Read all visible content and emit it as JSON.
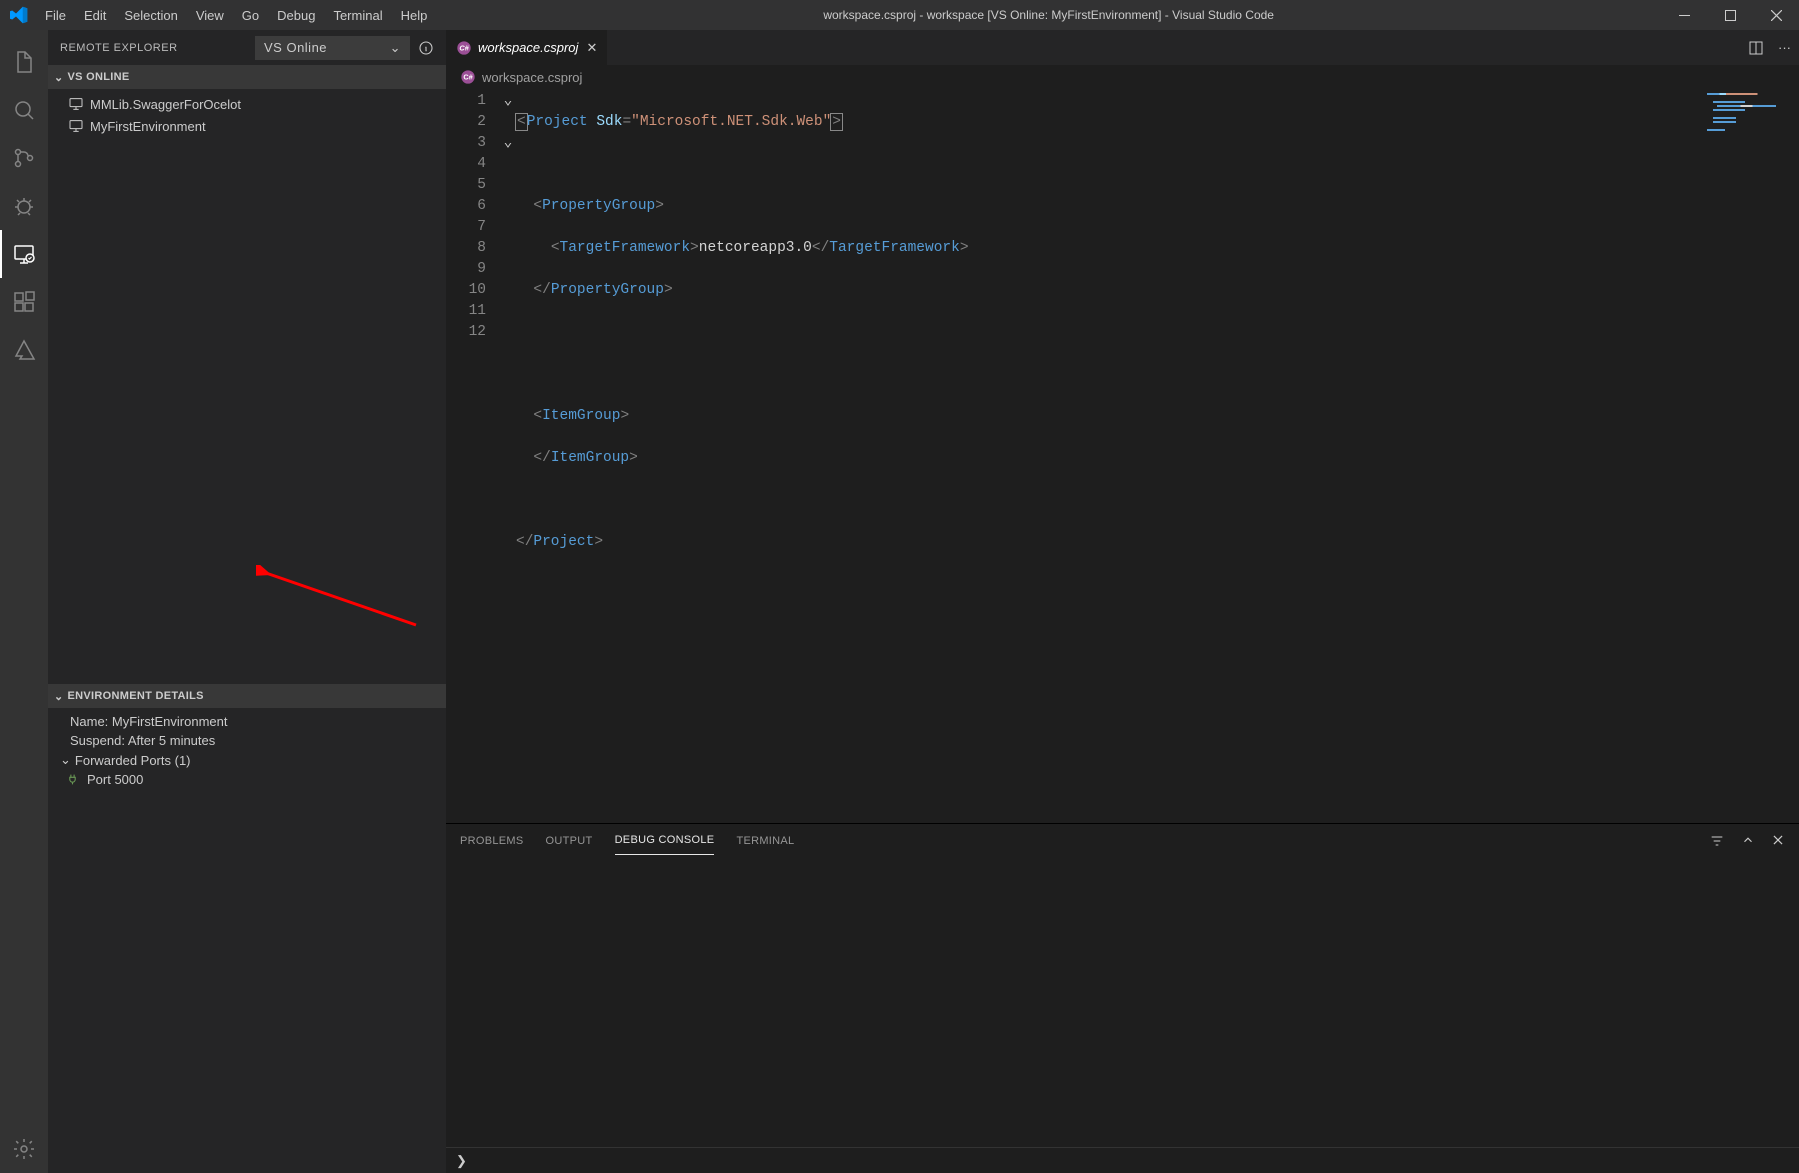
{
  "titlebar": {
    "title": "workspace.csproj - workspace [VS Online: MyFirstEnvironment] - Visual Studio Code",
    "menu": [
      "File",
      "Edit",
      "Selection",
      "View",
      "Go",
      "Debug",
      "Terminal",
      "Help"
    ]
  },
  "sidebar": {
    "explorer_label": "REMOTE EXPLORER",
    "dropdown_value": "VS Online",
    "section_vsonline": "VS ONLINE",
    "items": [
      {
        "label": "MMLib.SwaggerForOcelot"
      },
      {
        "label": "MyFirstEnvironment"
      }
    ],
    "envdetails_header": "ENVIRONMENT DETAILS",
    "env_name": "Name: MyFirstEnvironment",
    "env_suspend": "Suspend: After 5 minutes",
    "fwd_ports": "Forwarded Ports (1)",
    "port": "Port 5000"
  },
  "editor": {
    "tab_label": "workspace.csproj",
    "breadcrumb_label": "workspace.csproj",
    "line_numbers": [
      "1",
      "2",
      "3",
      "4",
      "5",
      "6",
      "7",
      "8",
      "9",
      "10",
      "11",
      "12"
    ]
  },
  "panel": {
    "tabs": {
      "problems": "PROBLEMS",
      "output": "OUTPUT",
      "debug_console": "DEBUG CONSOLE",
      "terminal": "TERMINAL"
    }
  }
}
